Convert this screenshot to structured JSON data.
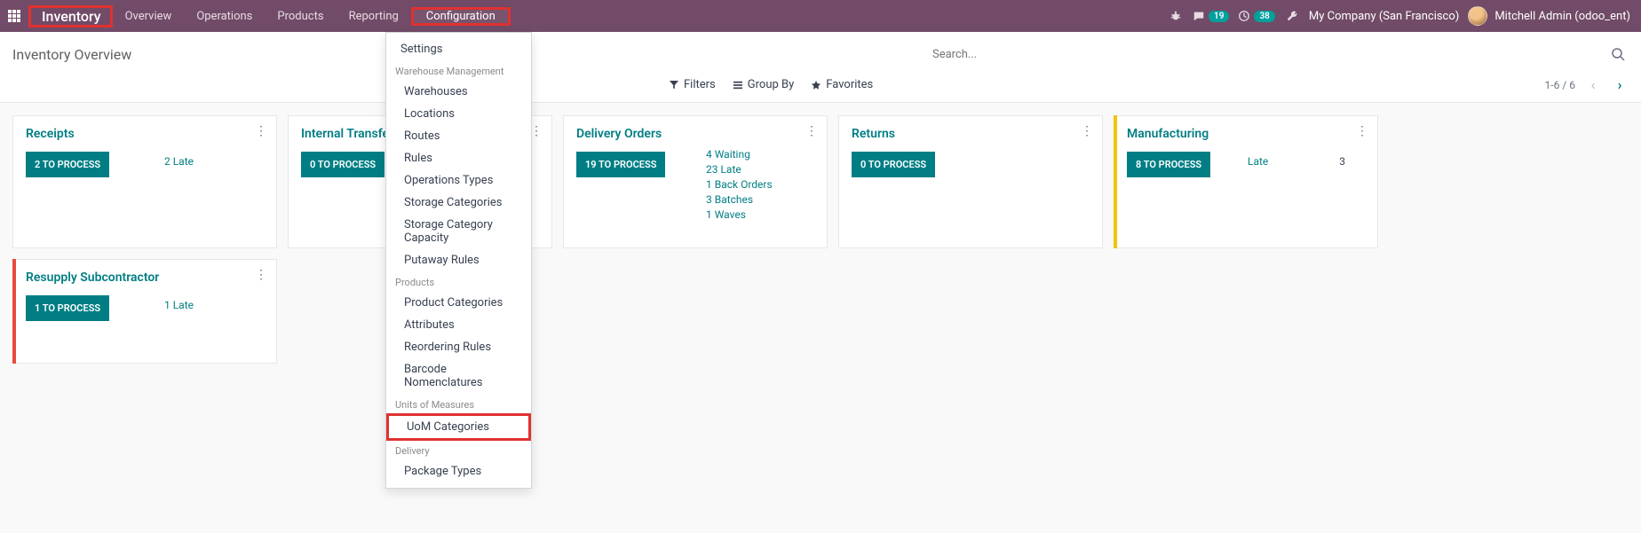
{
  "topbar": {
    "brand": "Inventory",
    "nav": [
      "Overview",
      "Operations",
      "Products",
      "Reporting",
      "Configuration"
    ],
    "chat_badge": "19",
    "activity_badge": "38",
    "company": "My Company (San Francisco)",
    "user": "Mitchell Admin (odoo_ent)"
  },
  "page": {
    "title": "Inventory Overview",
    "search_placeholder": "Search...",
    "filters_label": "Filters",
    "groupby_label": "Group By",
    "favorites_label": "Favorites",
    "pager": "1-6 / 6"
  },
  "cards": {
    "receipts": {
      "title": "Receipts",
      "btn": "2 TO PROCESS",
      "late": "2 Late"
    },
    "internal": {
      "title": "Internal Transfers",
      "btn": "0 TO PROCESS"
    },
    "delivery": {
      "title": "Delivery Orders",
      "btn": "19 TO PROCESS",
      "rows": [
        "4 Waiting",
        "23 Late",
        "1 Back Orders",
        "3 Batches",
        "1 Waves"
      ]
    },
    "returns": {
      "title": "Returns",
      "btn": "0 TO PROCESS"
    },
    "manufacturing": {
      "title": "Manufacturing",
      "btn": "8 TO PROCESS",
      "late_label": "Late",
      "late_count": "3"
    },
    "resupply": {
      "title": "Resupply Subcontractor",
      "btn": "1 TO PROCESS",
      "late": "1 Late"
    }
  },
  "dropdown": {
    "settings": "Settings",
    "h_wm": "Warehouse Management",
    "wm": [
      "Warehouses",
      "Locations",
      "Routes",
      "Rules",
      "Operations Types",
      "Storage Categories",
      "Storage Category Capacity",
      "Putaway Rules"
    ],
    "h_products": "Products",
    "products": [
      "Product Categories",
      "Attributes",
      "Reordering Rules",
      "Barcode Nomenclatures"
    ],
    "h_uom": "Units of Measures",
    "uom": [
      "UoM Categories"
    ],
    "h_delivery": "Delivery",
    "delivery": [
      "Package Types"
    ]
  }
}
